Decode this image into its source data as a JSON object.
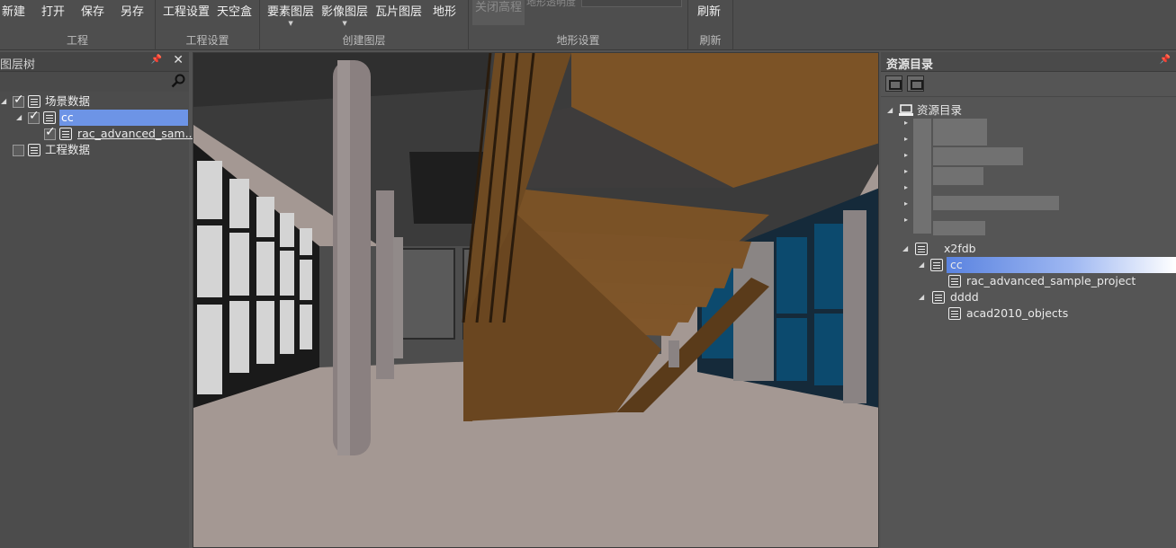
{
  "ribbon": {
    "groups": [
      {
        "label": "工程",
        "buttons": [
          "新建",
          "打开",
          "保存",
          "另存"
        ]
      },
      {
        "label": "工程设置",
        "buttons": [
          "工程设置",
          "天空盒"
        ]
      },
      {
        "label": "创建图层",
        "buttons": [
          "要素图层",
          "影像图层",
          "瓦片图层",
          "地形"
        ]
      },
      {
        "label": "地形设置",
        "buttons": [
          "关闭高程"
        ],
        "sub_text": "地形透明度"
      },
      {
        "label": "刷新",
        "buttons": [
          "刷新"
        ]
      }
    ]
  },
  "layer_panel": {
    "title": "图层树",
    "items": [
      {
        "label": "场景数据",
        "checked": true,
        "expanded": true
      },
      {
        "label": "cc",
        "checked": true,
        "expanded": true,
        "selected": true
      },
      {
        "label": "rac_advanced_sam...",
        "checked": true
      },
      {
        "label": "工程数据",
        "checked": false
      }
    ]
  },
  "resource_panel": {
    "title": "资源目录",
    "root": "资源目录",
    "items": [
      {
        "label": "x2fdb"
      },
      {
        "label": "cc",
        "selected": true
      },
      {
        "label": "rac_advanced_sample_project"
      },
      {
        "label": "dddd"
      },
      {
        "label": "acad2010_objects"
      }
    ]
  },
  "icons": {
    "search": "search-icon",
    "pin": "pin-icon",
    "close": "close-icon",
    "expand": "chevron-down-icon",
    "collapse": "chevron-right-icon",
    "document": "document-icon",
    "database": "database-icon",
    "computer": "computer-icon"
  },
  "colors": {
    "selection": "#6d94e6",
    "background": "#535353"
  }
}
